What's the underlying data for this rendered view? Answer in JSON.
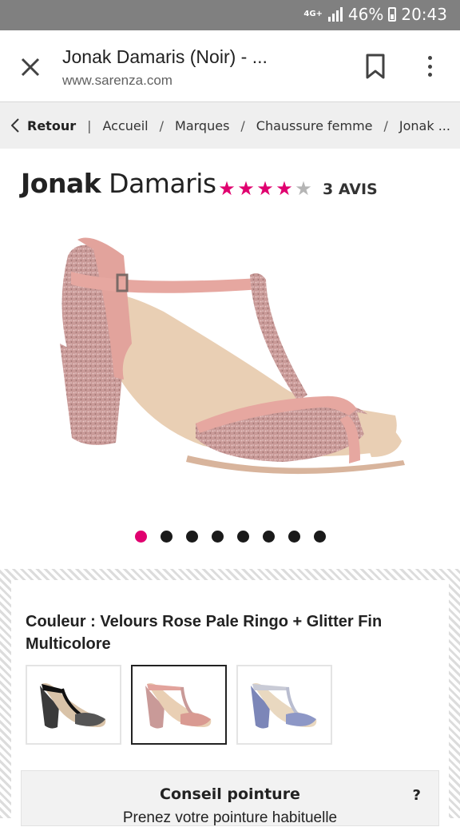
{
  "status_bar": {
    "network": "4G+",
    "battery": "46%",
    "time": "20:43"
  },
  "browser": {
    "title": "Jonak Damaris (Noir) - ...",
    "url": "www.sarenza.com",
    "close_icon": "close-icon",
    "bookmark_icon": "bookmark-icon",
    "menu_icon": "more-vert-icon"
  },
  "breadcrumb": {
    "back_label": "Retour",
    "items": [
      "Accueil",
      "Marques",
      "Chaussure femme",
      "Jonak ..."
    ]
  },
  "product": {
    "brand": "Jonak",
    "model": "Damaris",
    "rating": 4,
    "rating_max": 5,
    "reviews_label": "3 AVIS"
  },
  "carousel": {
    "total": 8,
    "active_index": 0
  },
  "colors": {
    "accent": "#e0006f",
    "label": "Couleur : Velours Rose Pale Ringo + Glitter Fin Multicolore",
    "swatches": [
      {
        "name": "black-glitter-variant",
        "selected": false
      },
      {
        "name": "pink-variant",
        "selected": true
      },
      {
        "name": "blue-variant",
        "selected": false
      }
    ]
  },
  "size_advice": {
    "title": "Conseil pointure",
    "help": "?",
    "text": "Prenez votre pointure habituelle"
  }
}
